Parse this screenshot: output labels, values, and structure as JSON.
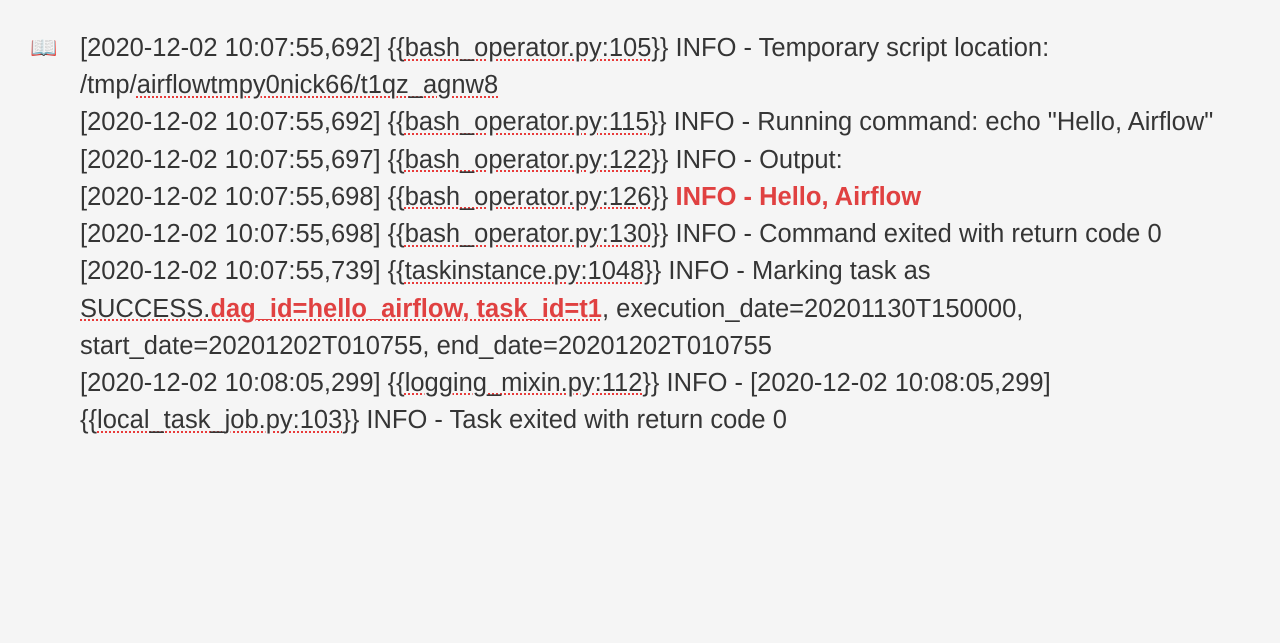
{
  "bullet_icon": "📖",
  "log": {
    "line1": {
      "a": "[2020-12-02 10:07:55,692] {{",
      "b": "bash_operator.py:105",
      "c": "}} INFO - Temporary script location: /tmp/",
      "d": "airflowtmpy0nick66/t1qz_agnw8"
    },
    "line2": {
      "a": "[2020-12-02 10:07:55,692] {{",
      "b": "bash_operator.py:115",
      "c": "}} INFO - Running command: echo \"Hello, Airflow\""
    },
    "line3": {
      "a": "[2020-12-02 10:07:55,697] {{",
      "b": "bash_operator.py:122",
      "c": "}} INFO - Output:"
    },
    "line4": {
      "a": "[2020-12-02 10:07:55,698] {{",
      "b": "bash_operator.py:126",
      "c": "}} ",
      "d": "INFO - Hello, Airflow"
    },
    "line5": {
      "a": "[2020-12-02 10:07:55,698] {{",
      "b": "bash_operator.py:130",
      "c": "}} INFO - Command exited with return code 0"
    },
    "line6": {
      "a": "[2020-12-02 10:07:55,739] {{",
      "b": "taskinstance.py:1048",
      "c": "}} INFO - Marking task as ",
      "d": "SUCCESS.",
      "e": "dag_id=hello_airflow, task_id=t1",
      "f": ", execution_date=20201130T150000, start_date=20201202T010755, end_date=20201202T010755"
    },
    "line7": {
      "a": "[2020-12-02 10:08:05,299] {{",
      "b": "logging_mixin.py:112",
      "c": "}} INFO - [2020-12-02 10:08:05,299] {{",
      "d": "local_task_job.py:103",
      "e": "}} INFO - Task exited with return code 0"
    }
  }
}
